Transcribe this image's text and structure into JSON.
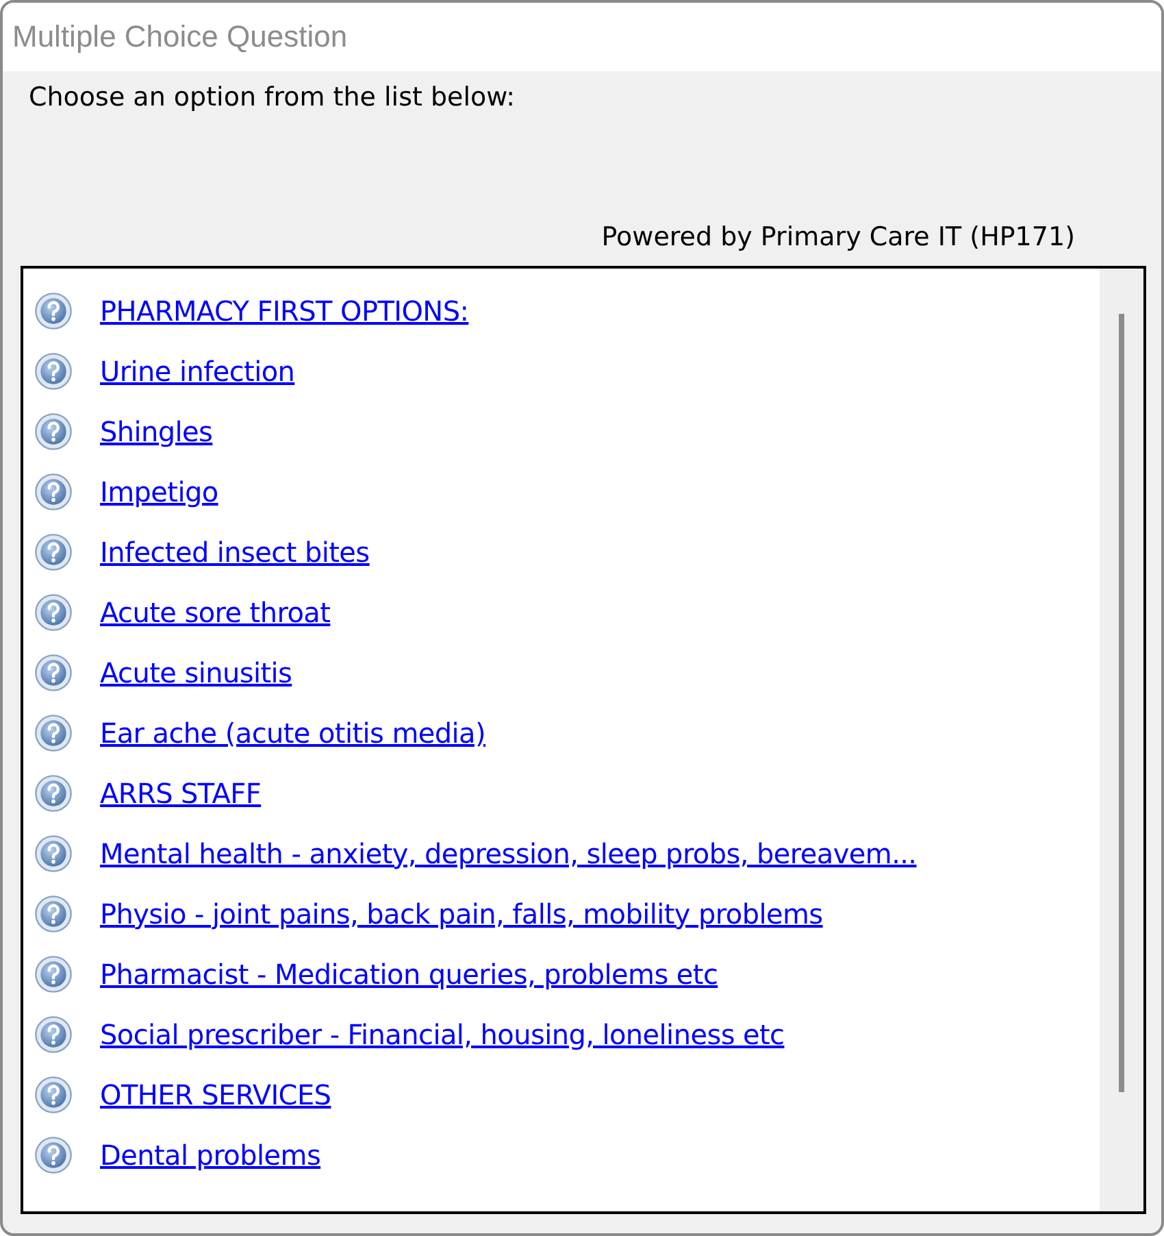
{
  "window": {
    "title": "Multiple Choice Question"
  },
  "prompt": "Choose an option from the list below:",
  "credit": "Powered by Primary Care IT (HP171)",
  "options": [
    {
      "label": "PHARMACY FIRST OPTIONS:"
    },
    {
      "label": "Urine infection"
    },
    {
      "label": "Shingles"
    },
    {
      "label": "Impetigo"
    },
    {
      "label": "Infected insect bites"
    },
    {
      "label": "Acute sore throat"
    },
    {
      "label": "Acute sinusitis"
    },
    {
      "label": "Ear ache (acute otitis media)"
    },
    {
      "label": "ARRS STAFF"
    },
    {
      "label": "Mental health - anxiety, depression, sleep probs, bereavem..."
    },
    {
      "label": "Physio - joint pains, back pain, falls, mobility problems"
    },
    {
      "label": "Pharmacist - Medication queries, problems etc"
    },
    {
      "label": "Social prescriber - Financial, housing, loneliness etc"
    },
    {
      "label": "OTHER SERVICES"
    },
    {
      "label": "Dental problems"
    }
  ]
}
